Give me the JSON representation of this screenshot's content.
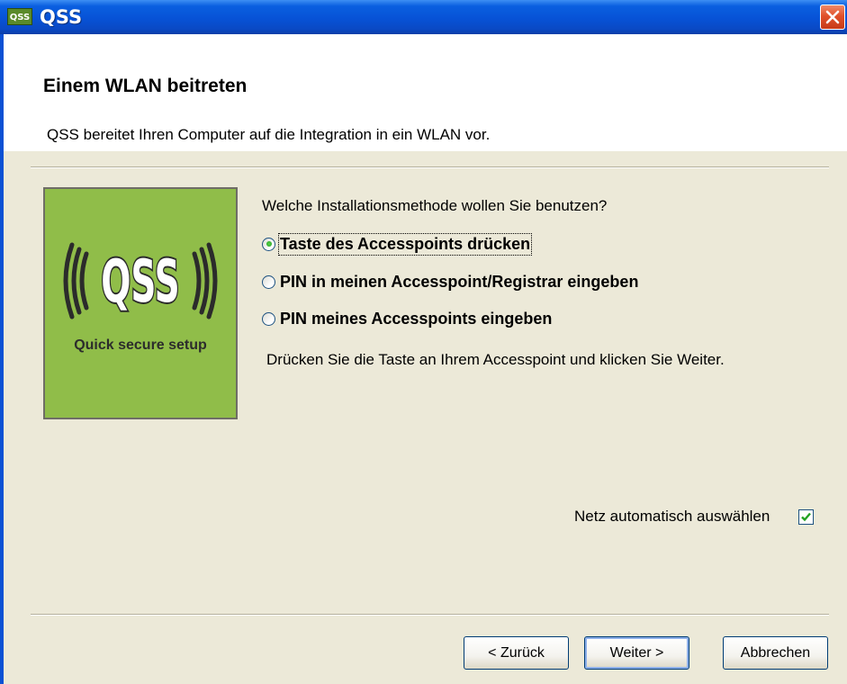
{
  "window": {
    "app_icon_text": "QSS",
    "title": "QSS"
  },
  "header": {
    "heading": "Einem WLAN beitreten",
    "subheading": "QSS bereitet Ihren Computer auf die Integration in ein WLAN vor."
  },
  "logo": {
    "mark": "((QSS))",
    "tagline": "Quick secure setup",
    "background_color": "#90bd49"
  },
  "content": {
    "question": "Welche Installationsmethode wollen Sie benutzen?",
    "options": [
      {
        "label": "Taste des Accesspoints drücken",
        "selected": true
      },
      {
        "label": "PIN in meinen Accesspoint/Registrar eingeben",
        "selected": false
      },
      {
        "label": "PIN meines Accesspoints eingeben",
        "selected": false
      }
    ],
    "hint": "Drücken Sie die Taste an Ihrem Accesspoint und klicken Sie Weiter."
  },
  "auto_select": {
    "label": "Netz automatisch auswählen",
    "checked": true
  },
  "buttons": {
    "back": "< Zurück",
    "next": "Weiter >",
    "cancel": "Abbrechen"
  },
  "colors": {
    "titlebar": "#0752d6",
    "dialog_background": "#ece9d8",
    "radio_selected": "#21a121",
    "close_button": "#e0502a"
  }
}
